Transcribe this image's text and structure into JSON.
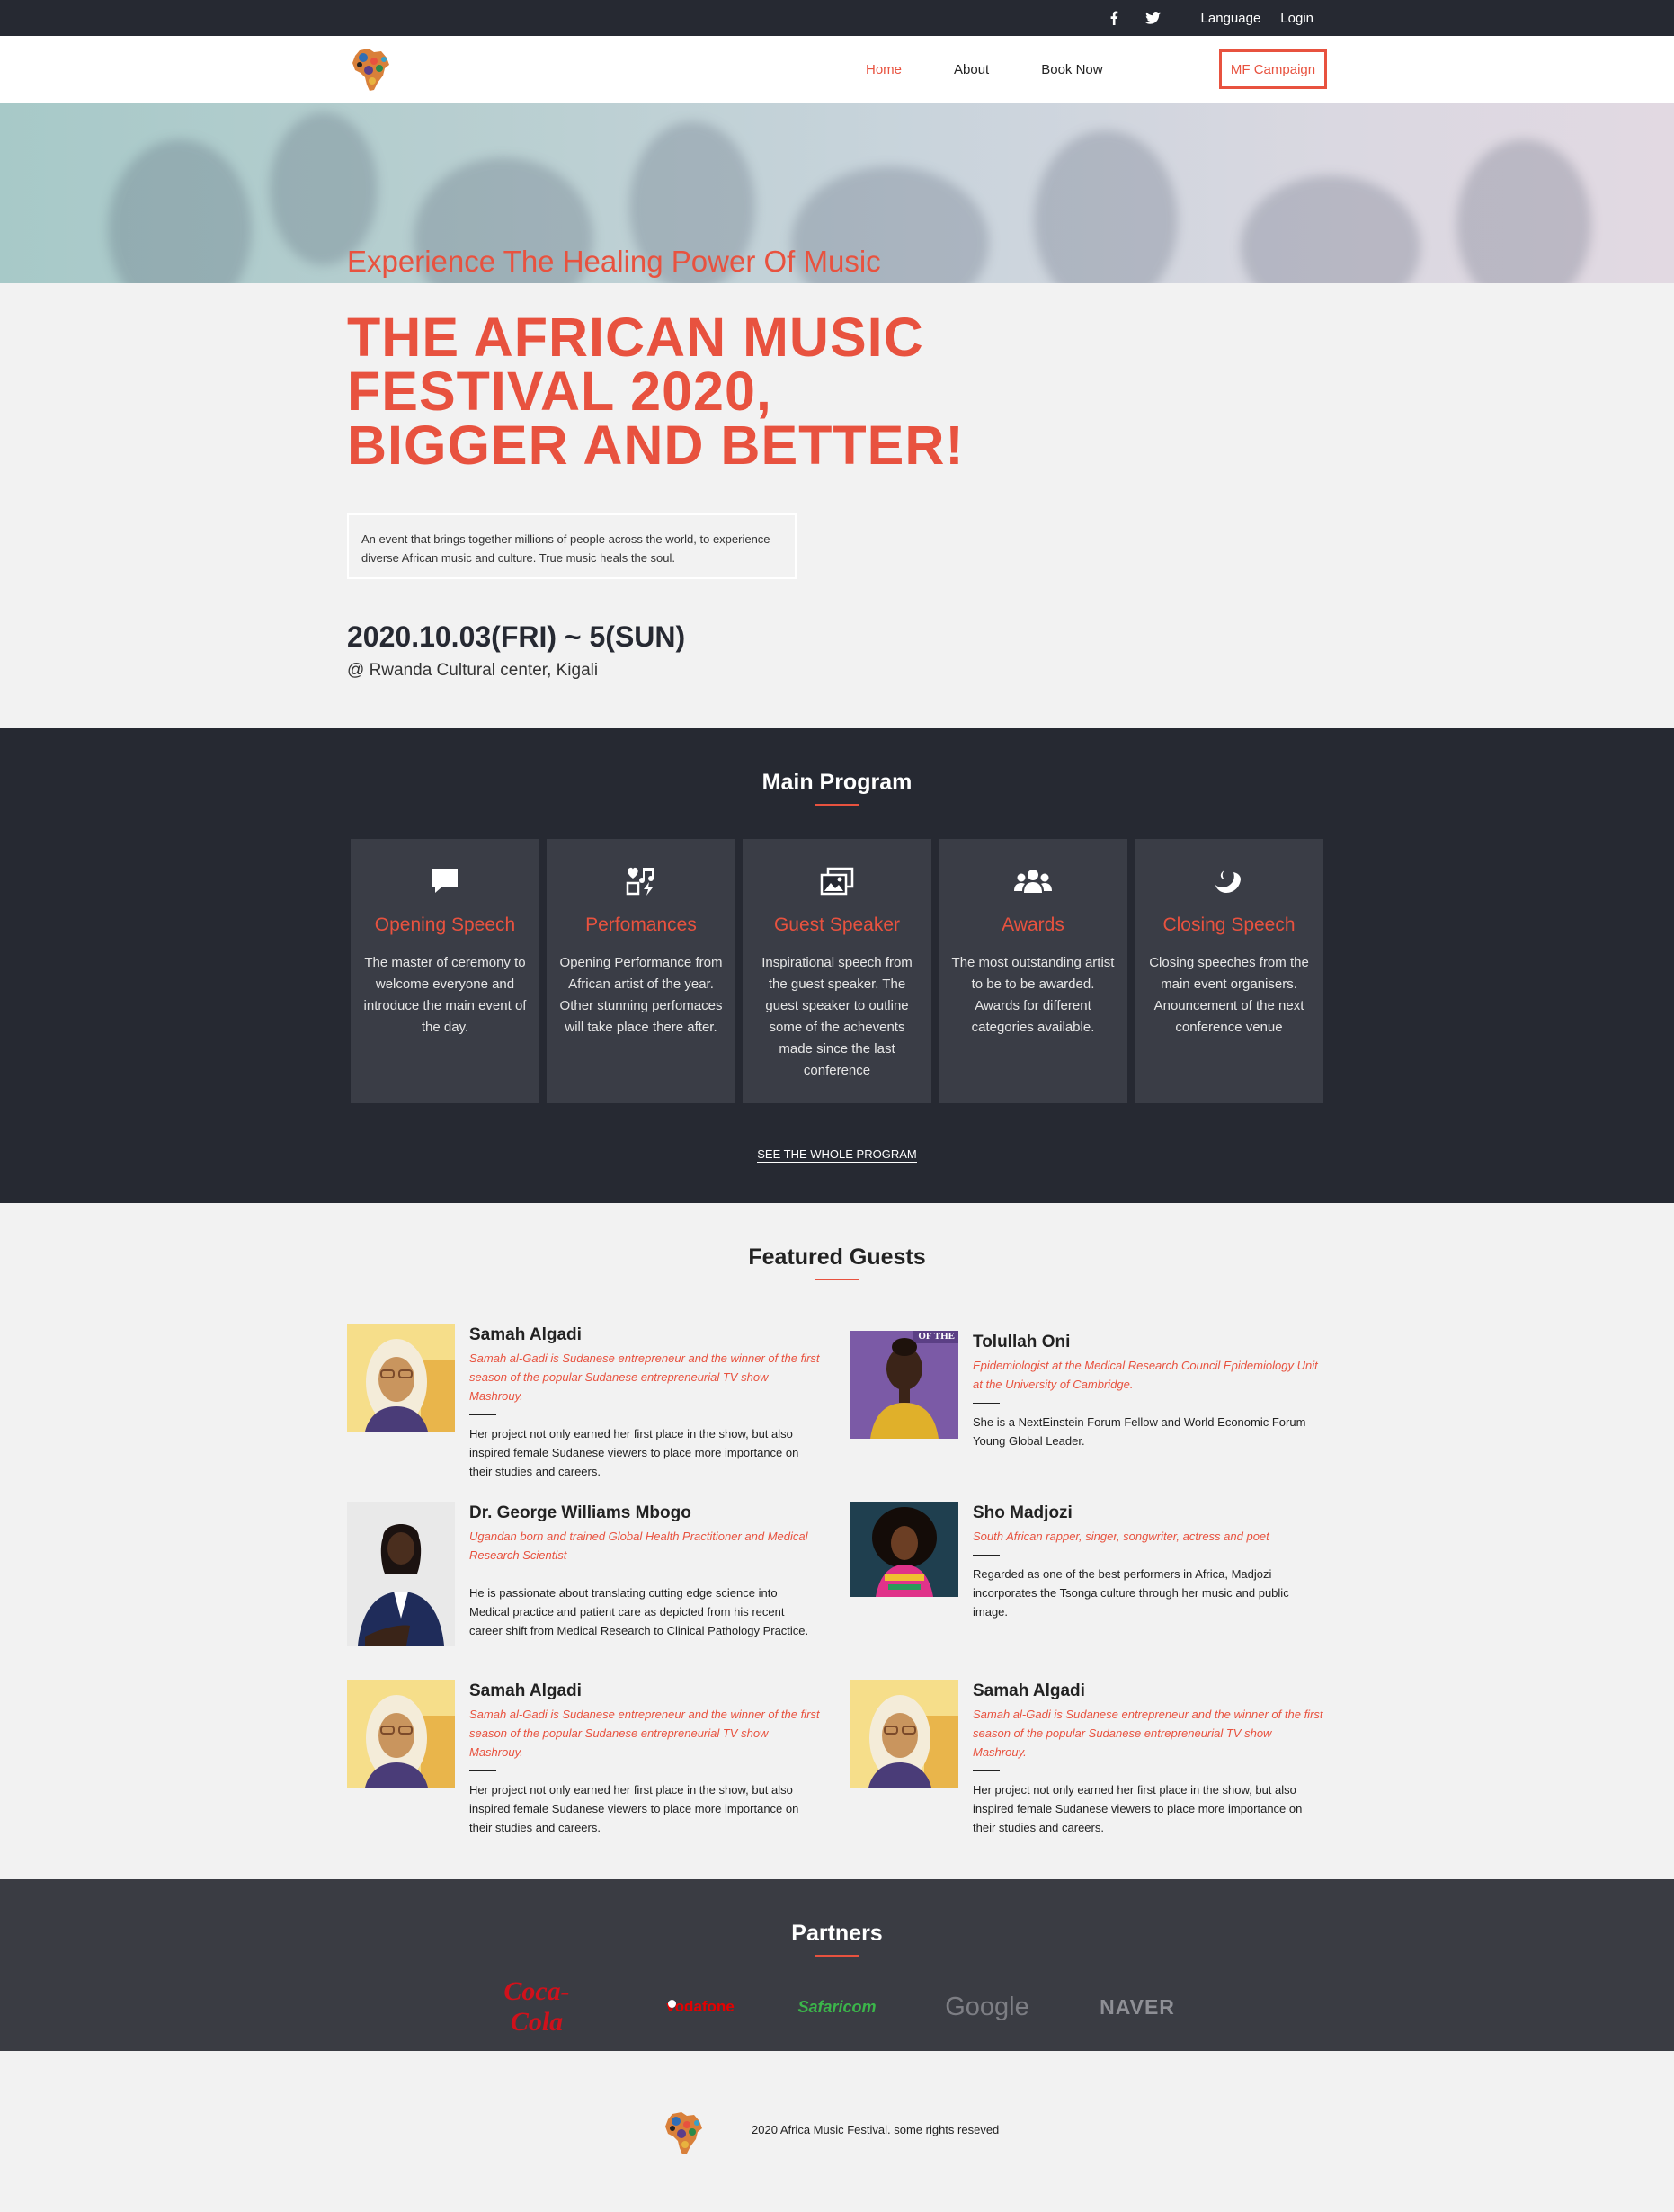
{
  "topbar": {
    "facebook_icon": "facebook-icon",
    "twitter_icon": "twitter-icon",
    "language": "Language",
    "login": "Login"
  },
  "nav": {
    "logo_icon": "africa-map-logo",
    "items": [
      "Home",
      "About",
      "Book Now"
    ],
    "active": "Home",
    "cta": "MF Campaign"
  },
  "hero": {
    "subtitle": "Experience The Healing Power Of Music",
    "title_line1": "THE AFRICAN MUSIC",
    "title_line2": "FESTIVAL 2020,",
    "title_line3": "BIGGER AND BETTER!",
    "description": "An event that brings together millions of people across the world, to experience diverse African music and culture. True music heals the soul.",
    "date": "2020.10.03(FRI) ~ 5(SUN)",
    "venue": "@ Rwanda Cultural center, Kigali"
  },
  "program": {
    "title": "Main Program",
    "cards": [
      {
        "icon": "speech-bubble-icon",
        "title": "Opening Speech",
        "text": "The master of ceremony to welcome everyone and introduce the main event of the day."
      },
      {
        "icon": "music-heart-icon",
        "title": "Perfomances",
        "text": "Opening Performance from African artist of the year. Other stunning perfomaces will take place there after."
      },
      {
        "icon": "photos-icon",
        "title": "Guest Speaker",
        "text": "Inspirational speech from the guest speaker. The guest speaker to outline some of the achevents made since the last conference"
      },
      {
        "icon": "users-icon",
        "title": "Awards",
        "text": "The most outstanding artist to be to be awarded. Awards for different categories available."
      },
      {
        "icon": "moon-icon",
        "title": "Closing Speech",
        "text": "Closing speeches from the main event organisers. Anouncement of the next conference venue"
      }
    ],
    "more_link": "SEE THE WHOLE PROGRAM"
  },
  "guests": {
    "title": "Featured Guests",
    "list": [
      {
        "name": "Samah Algadi",
        "role": "Samah al-Gadi is Sudanese entrepreneur and the winner of the first season of the popular Sudanese entrepreneurial TV show Mashrouy.",
        "bio": "Her project not only earned her first place in the show, but also inspired female Sudanese viewers to place more importance on their studies and careers."
      },
      {
        "name": "Tolullah Oni",
        "role": "Epidemiologist at the Medical Research Council Epidemiology Unit at the University of Cambridge.",
        "bio": "She is a NextEinstein Forum Fellow and World Economic Forum Young Global Leader.",
        "photo_caption": "OF THE"
      },
      {
        "name": "Dr. George Williams Mbogo",
        "role": "Ugandan born and trained Global Health Practitioner and Medical Research Scientist",
        "bio": "He is passionate about translating cutting edge science into Medical practice and patient care as depicted from his recent career shift from Medical Research to Clinical Pathology Practice."
      },
      {
        "name": "Sho Madjozi",
        "role": "South African rapper, singer, songwriter, actress and poet",
        "bio": "Regarded as one of the best performers in Africa, Madjozi incorporates the Tsonga culture through her music and public image."
      },
      {
        "name": "Samah Algadi",
        "role": "Samah al-Gadi is Sudanese entrepreneur and the winner of the first season of the popular Sudanese entrepreneurial TV show Mashrouy.",
        "bio": "Her project not only earned her first place in the show, but also inspired female Sudanese viewers to place more importance on their studies and careers."
      },
      {
        "name": "Samah Algadi",
        "role": "Samah al-Gadi is Sudanese entrepreneur and the winner of the first season of the popular Sudanese entrepreneurial TV show Mashrouy.",
        "bio": "Her project not only earned her first place in the show, but also inspired female Sudanese viewers to place more importance on their studies and careers."
      }
    ]
  },
  "partners": {
    "title": "Partners",
    "logos": [
      "Coca-Cola",
      "vodafone",
      "Safaricom",
      "Google",
      "NAVER"
    ]
  },
  "footer": {
    "copyright": "2020 Africa Music Festival. some rights reseved"
  },
  "colors": {
    "accent": "#e8523f",
    "dark": "#262932",
    "card": "#3a3d46",
    "partners_bg": "#3a3c43",
    "page_bg": "#f2f2f2"
  }
}
